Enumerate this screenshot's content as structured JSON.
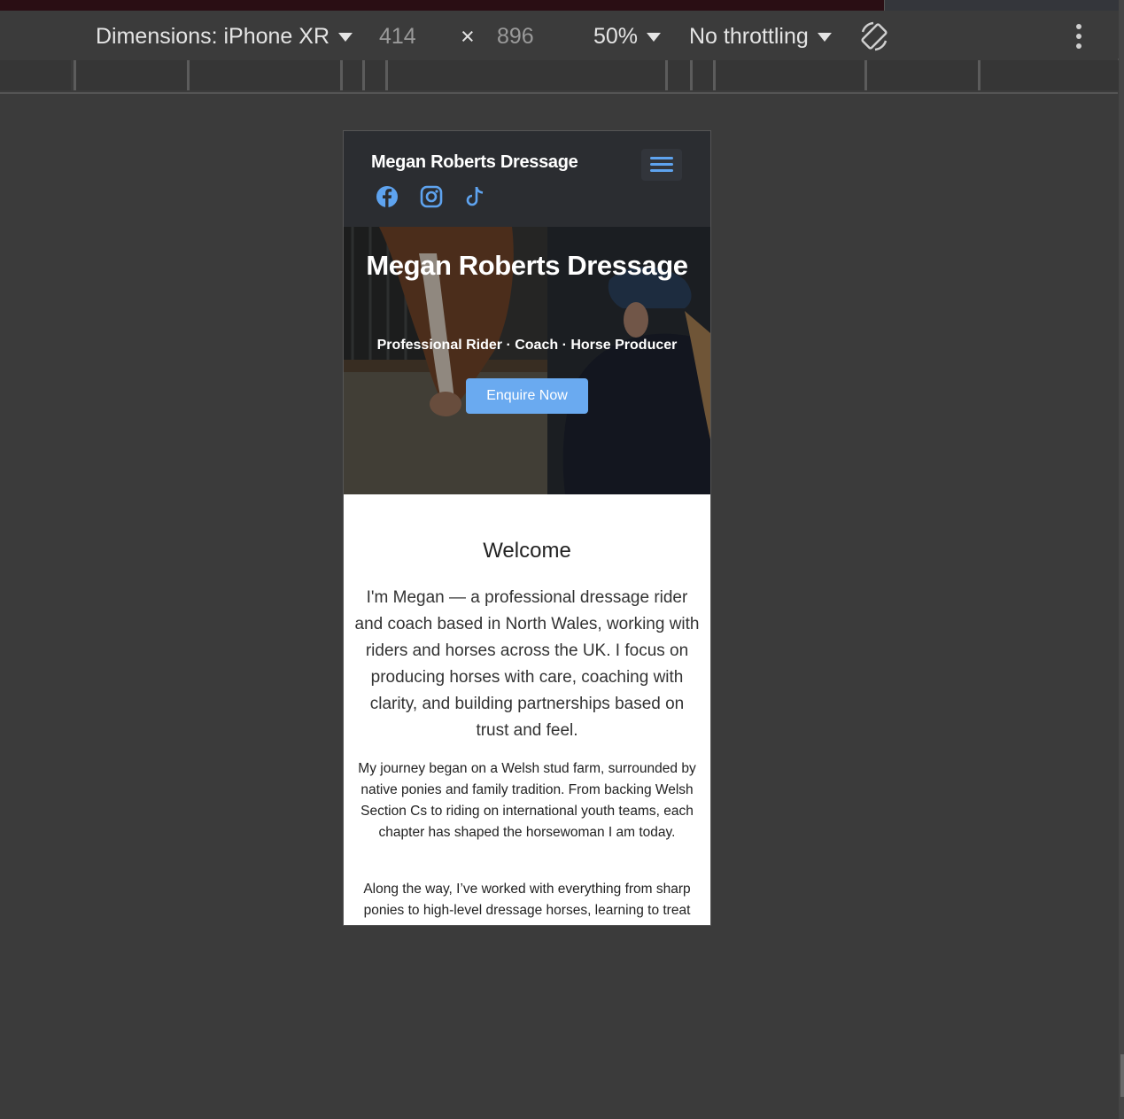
{
  "devtools": {
    "dimensions_label": "Dimensions: iPhone XR",
    "width": "414",
    "times": "×",
    "height": "896",
    "zoom": "50%",
    "throttling": "No throttling",
    "rotate_icon": "rotate-icon",
    "more_icon": "more-vert-icon"
  },
  "site": {
    "brand": "Megan Roberts Dressage",
    "social_icons": [
      "facebook-icon",
      "instagram-icon",
      "tiktok-icon"
    ],
    "accent_color": "#5ea3ef",
    "hero": {
      "title": "Megan Roberts Dressage",
      "subtitle": "Professional Rider · Coach · Horse Producer",
      "cta": "Enquire Now"
    },
    "welcome": {
      "heading": "Welcome",
      "lead": "I'm Megan — a professional dressage rider and coach based in North Wales, working with riders and horses across the UK. I focus on producing horses with care, coaching with clarity, and building partnerships based on trust and feel.",
      "para1": "My journey began on a Welsh stud farm, surrounded by native ponies and family tradition. From backing Welsh Section Cs to riding on international youth teams, each chapter has shaped the horsewoman I am today.",
      "para2": "Along the way, I’ve worked with everything from sharp ponies to high-level dressage horses, learning to treat"
    }
  }
}
